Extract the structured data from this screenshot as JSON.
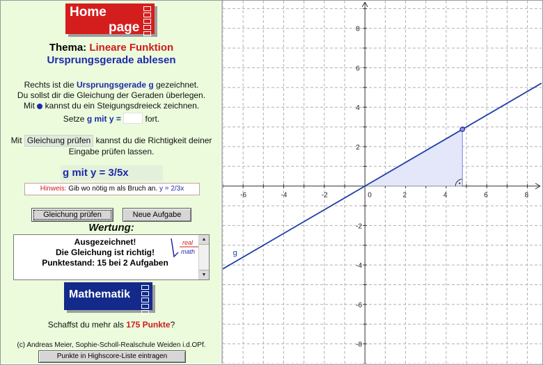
{
  "home_logo": {
    "line1": "Home",
    "line2": "page"
  },
  "header": {
    "thema_label": "Thema:",
    "thema_value": "Lineare Funktion",
    "subtitle": "Ursprungsgerade ablesen"
  },
  "instructions": {
    "line1_pre": "Rechts ist die ",
    "line1_bold": "Ursprungsgerade g",
    "line1_post": " gezeichnet.",
    "line2": "Du sollst dir die Gleichung der Geraden überlegen.",
    "line3_pre": "Mit ",
    "line3_post": " kannst du ein Steigungsdreieck zeichnen.",
    "line4_pre": "Setze ",
    "line4_bold": "g mit y =",
    "line4_post": " fort.",
    "line5_pre": "Mit ",
    "line5_pill": "Gleichung prüfen",
    "line5_post": " kannst du die Richtigkeit deiner",
    "line6": "Eingabe prüfen lassen."
  },
  "formula": "g mit y = 3/5x",
  "hint": {
    "label": "Hinweis:",
    "text": " Gib wo nötig m als Bruch an. ",
    "example": "y = 2/3x"
  },
  "buttons": {
    "check": "Gleichung prüfen",
    "new_task": "Neue Aufgabe",
    "highscore": "Punkte in Highscore-Liste eintragen"
  },
  "wertung": {
    "title": "Wertung:",
    "line1": "Ausgezeichnet!",
    "line2": "Die Gleichung ist richtig!",
    "line3": "Punktestand: 15 bei 2 Aufgaben",
    "logo_top": "real",
    "logo_bottom": "math"
  },
  "math_logo": "Mathematik",
  "challenge": {
    "pre": "Schaffst du mehr als ",
    "points": "175 Punkte",
    "post": "?"
  },
  "copyright": "(c) Andreas Meier, Sophie-Scholl-Realschule Weiden i.d.OPf.",
  "graph": {
    "line_label": "g",
    "slope_num": 3,
    "slope_den": 5,
    "point_x": 4.8,
    "x_range": [
      -7,
      8.7
    ],
    "y_range": [
      -9,
      9.4
    ],
    "x_tick_labels": [
      "-6",
      "-4",
      "-2",
      "0",
      "2",
      "4",
      "6",
      "8"
    ],
    "y_tick_labels": [
      "8",
      "6",
      "4",
      "2",
      "0",
      "-2",
      "-4",
      "-6",
      "-8"
    ],
    "colors": {
      "line": "#1e3fa8",
      "triangle_fill": "#e4e6fa",
      "grid": "#b0b0b0"
    }
  }
}
